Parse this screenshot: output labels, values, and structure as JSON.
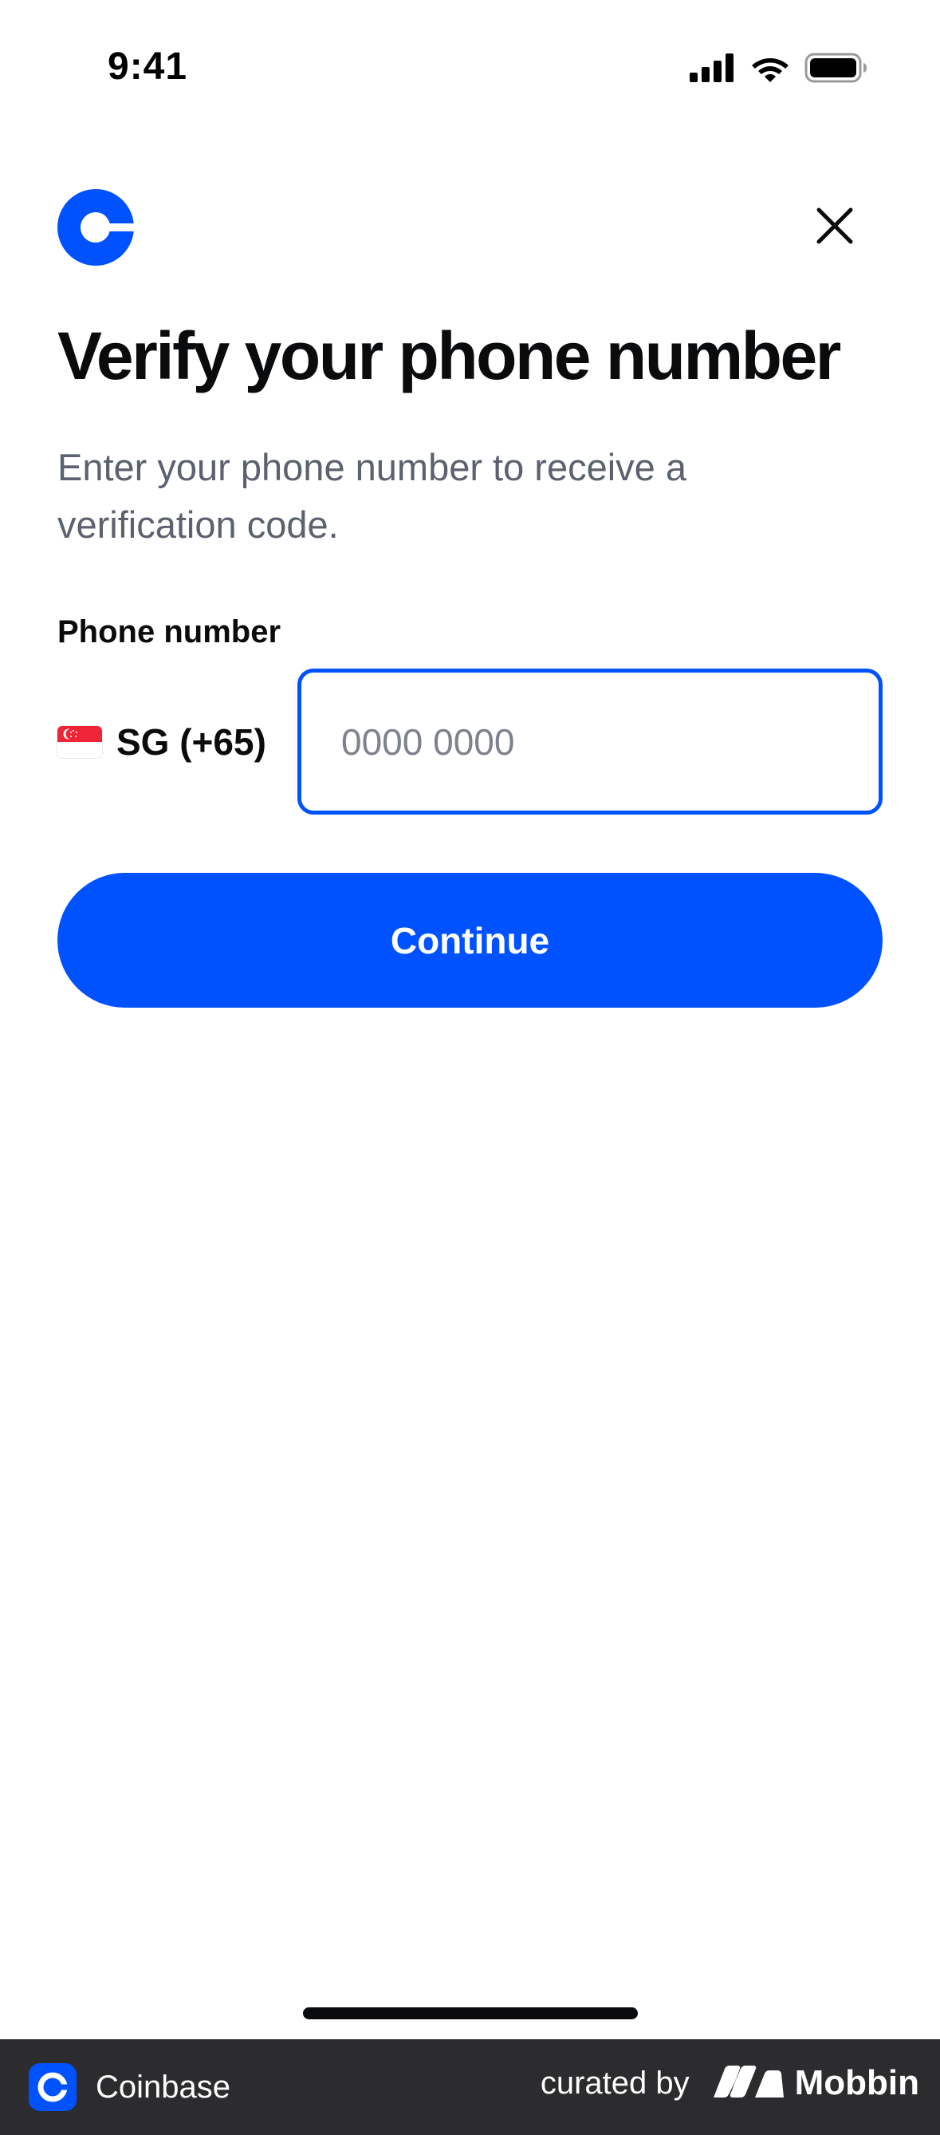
{
  "status_bar": {
    "time": "9:41"
  },
  "header": {
    "logo_icon": "coinbase-logo-icon",
    "close_icon": "close-icon"
  },
  "content": {
    "title": "Verify your phone number",
    "subtitle": "Enter your phone number to receive a verification code.",
    "field_label": "Phone number",
    "country": {
      "flag_icon": "singapore-flag-icon",
      "code": "SG (+65)"
    },
    "phone_input": {
      "value": "",
      "placeholder": "0000 0000"
    },
    "continue_label": "Continue"
  },
  "branding": {
    "app_name": "Coinbase",
    "curated_by": "curated by",
    "curator": "Mobbin"
  },
  "colors": {
    "accent": "#0052ff",
    "text_primary": "#0a0b0d",
    "text_secondary": "#5b616e",
    "brand_bar": "#2c2c2e"
  }
}
